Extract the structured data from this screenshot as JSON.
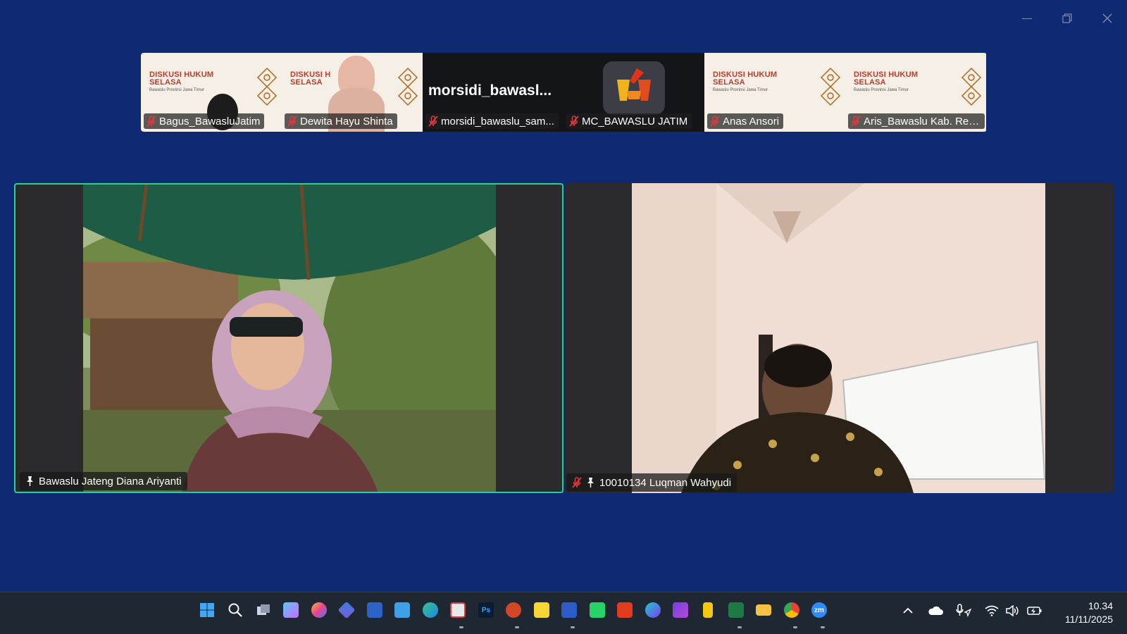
{
  "window": {
    "minimize_label": "",
    "maximize_label": "",
    "close_label": ""
  },
  "thumbnails": [
    {
      "name": "Bagus_BawasluJatim",
      "banner_title": "DISKUSI HUKUM\nSELASA"
    },
    {
      "name": "Dewita Hayu Shinta",
      "banner_title": "DISKUSI H\nSELASA"
    },
    {
      "name": "morsidi_bawaslu_sam...",
      "display_name": "morsidi_bawasl..."
    },
    {
      "name": "MC_BAWASLU JATIM"
    },
    {
      "name": "Anas Ansori",
      "banner_title": "DISKUSI HUKUM\nSELASA"
    },
    {
      "name": "Aris_Bawaslu Kab. Rem...",
      "banner_title": "DISKUSI HUKUM\nSELASA"
    }
  ],
  "banner_subtitle": "Bawaslu Provinsi Jawa Timur",
  "main": {
    "left": {
      "name": "Bawaslu Jateng Diana Ariyanti"
    },
    "right": {
      "name": "10010134 Luqman Wahyudi"
    }
  },
  "taskbar": {
    "icons": [
      "windows-start-icon",
      "search-icon",
      "task-view-icon",
      "copilot-icon",
      "teams-icon",
      "store-icon",
      "notepad-icon",
      "edge-icon",
      "snipping-tool-icon",
      "photoshop-icon",
      "powerpoint-icon",
      "sticky-notes-icon",
      "word-icon",
      "whatsapp-icon",
      "acrobat-icon",
      "canva-icon",
      "clipchamp-icon",
      "power-bi-icon",
      "excel-icon",
      "file-explorer-icon",
      "chrome-icon",
      "zoom-icon"
    ],
    "photoshop_text": "Ps",
    "zoom_text": "zm",
    "clock_time": "10.34",
    "clock_date": "11/11/2025"
  },
  "colors": {
    "background": "#0f2a73",
    "active_border": "#22d48f",
    "taskbar": "#1f2733"
  }
}
